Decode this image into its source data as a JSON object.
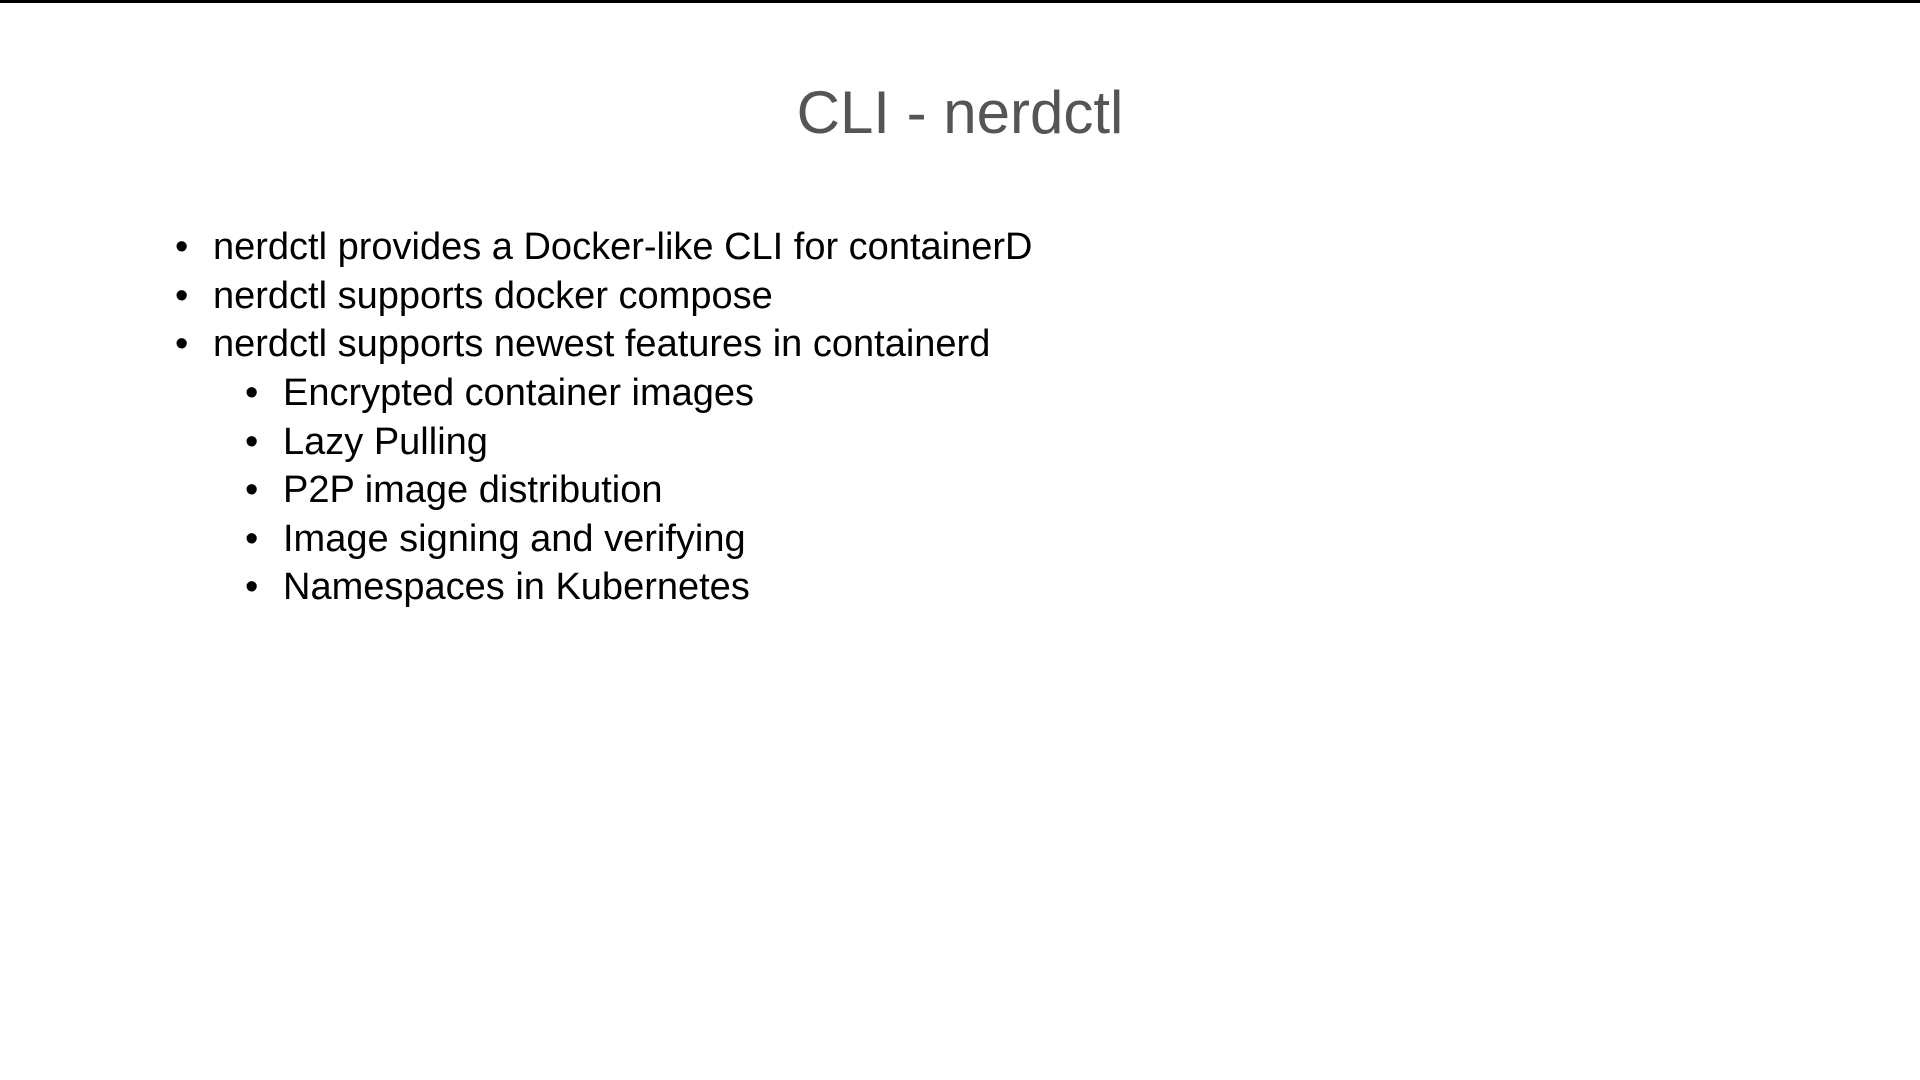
{
  "slide": {
    "title": "CLI - nerdctl",
    "bullets": [
      {
        "text": "nerdctl provides a Docker-like CLI for containerD"
      },
      {
        "text": "nerdctl supports docker compose"
      },
      {
        "text": "nerdctl supports newest features in containerd",
        "subbullets": [
          "Encrypted container images",
          "Lazy Pulling",
          "P2P image distribution",
          "Image signing and verifying",
          "Namespaces in Kubernetes"
        ]
      }
    ]
  }
}
